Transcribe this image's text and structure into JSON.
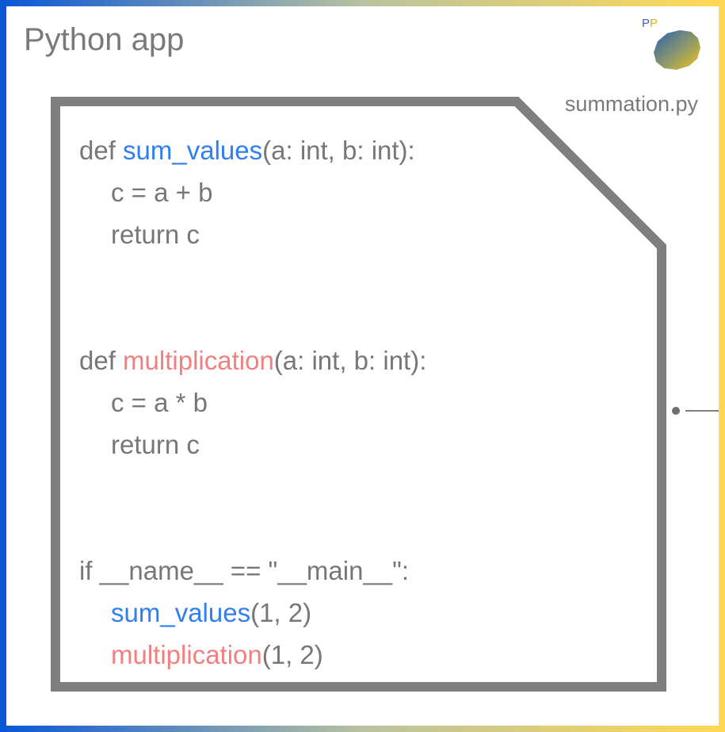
{
  "app": {
    "title": "Python app"
  },
  "file": {
    "name": "summation.py"
  },
  "logo": {
    "letter_1": "P",
    "letter_2": "P"
  },
  "code": {
    "func1": {
      "keyword": "def",
      "name": "sum_values",
      "params": "(a: int, b: int):",
      "body_1": "c = a + b",
      "body_2": "return c"
    },
    "func2": {
      "keyword": "def",
      "name": "multiplication",
      "params": "(a: int, b: int):",
      "body_1": "c = a * b",
      "body_2": "return c"
    },
    "main": {
      "condition": "if __name__ == \"__main__\":",
      "call_1_name": "sum_values",
      "call_1_args": "(1, 2)",
      "call_2_name": "multiplication",
      "call_2_args": "(1, 2)"
    }
  },
  "colors": {
    "frame_gradient_start": "#0a57d6",
    "frame_gradient_end": "#ffd955",
    "file_border": "#7f7f7f",
    "text_gray": "#777777",
    "highlight_blue": "#2f7ff0",
    "highlight_red": "#f28080"
  }
}
